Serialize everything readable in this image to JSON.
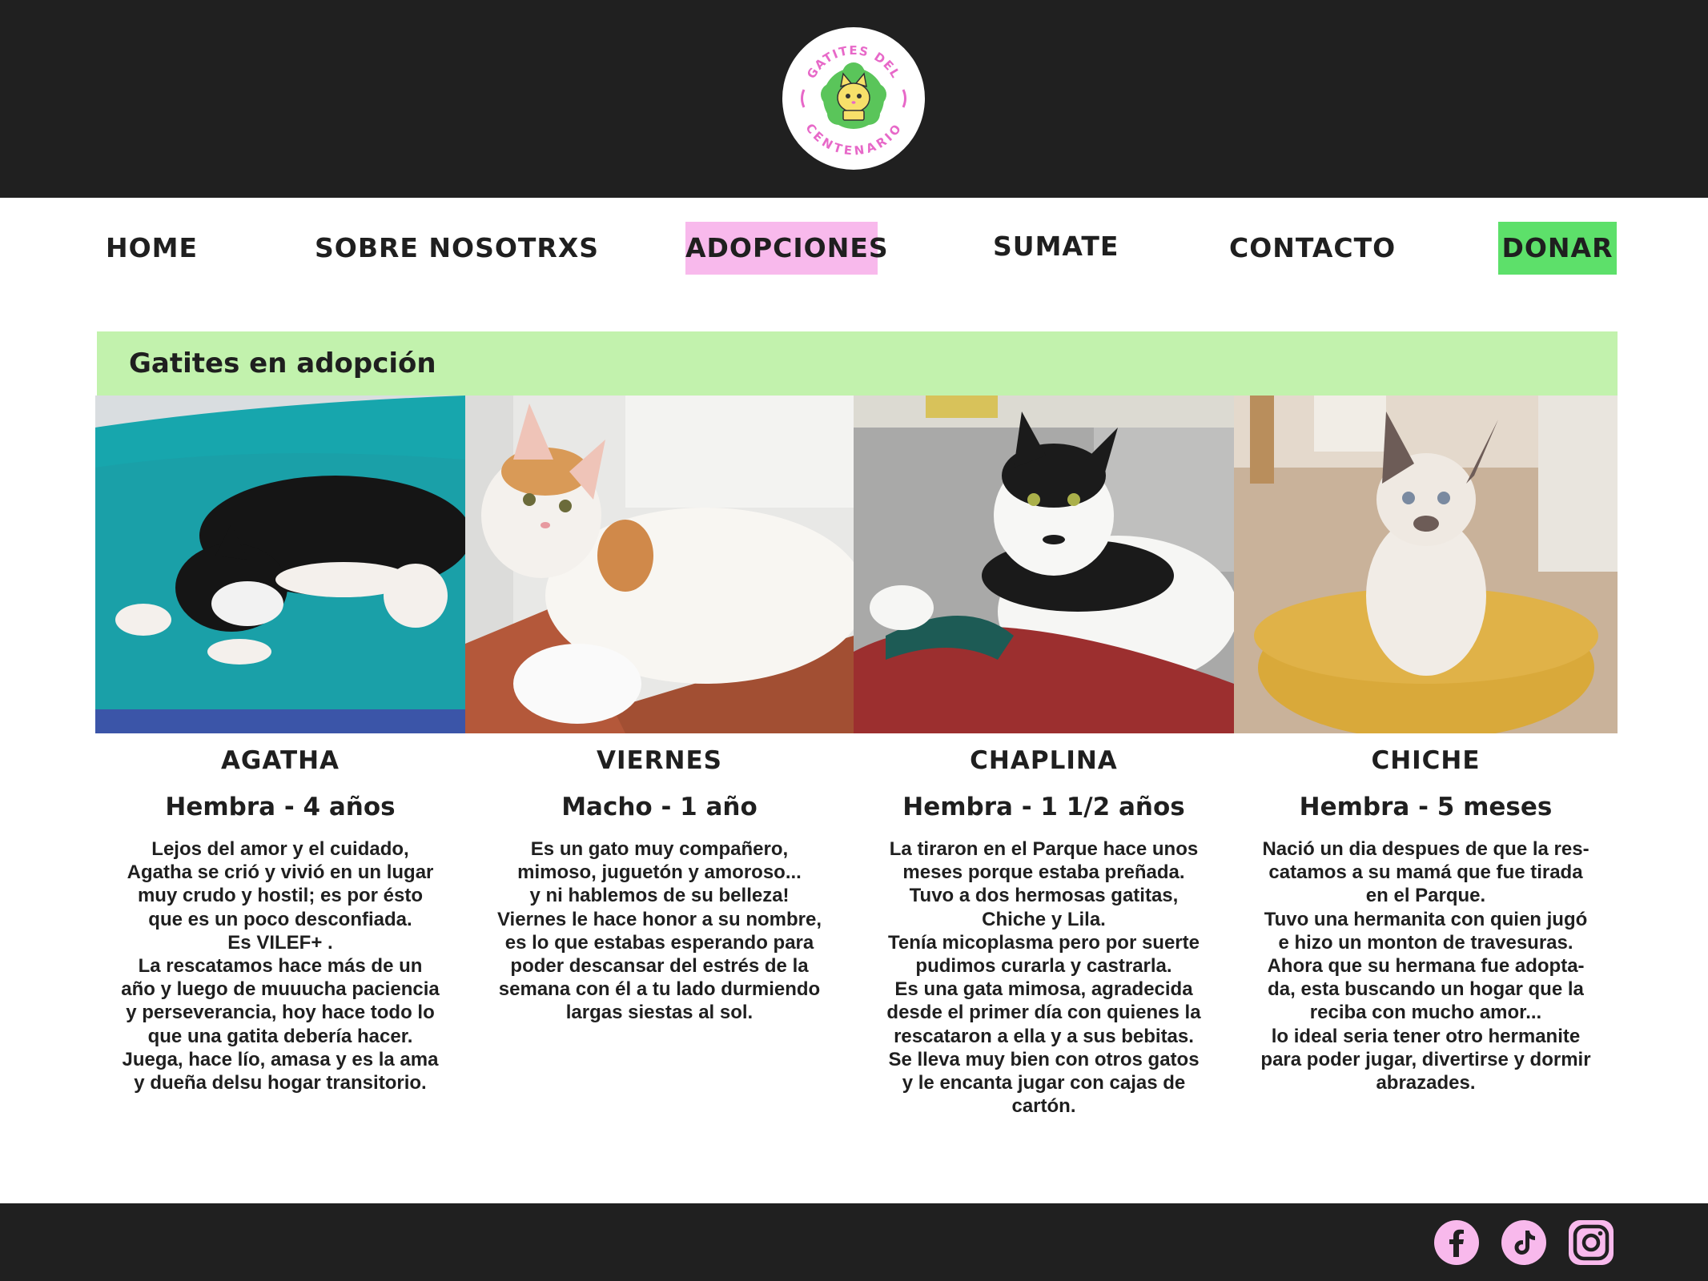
{
  "brand": {
    "logo_text_top": "GATITES DEL",
    "logo_text_bottom": "CENTENARIO",
    "colors": {
      "pink": "#f8b9ec",
      "green": "#5de06a",
      "light_green": "#c2f2ad",
      "dark": "#202020"
    }
  },
  "nav": {
    "home": "HOME",
    "about": "SOBRE NOSOTRXS",
    "adoptions": "ADOPCIONES",
    "join": "SUMATE",
    "contact": "CONTACTO",
    "donate": "DONAR",
    "active": "ADOPCIONES"
  },
  "section": {
    "title": "Gatites en adopción"
  },
  "cats": [
    {
      "name": "AGATHA",
      "info": "Hembra - 4 años",
      "description": "Lejos del amor y el cuidado,\nAgatha se crió y vivió en un lugar\nmuy crudo y hostil; es por ésto\nque es un poco desconfiada.\nEs VILEF+ .\nLa rescatamos hace más de un\naño y luego de muuucha paciencia\ny perseverancia, hoy hace todo lo\nque una gatita debería hacer.\nJuega, hace lío, amasa y es la ama\ny dueña delsu hogar transitorio."
    },
    {
      "name": "VIERNES",
      "info": "Macho - 1 año",
      "description": "Es un gato muy compañero,\nmimoso, juguetón y amoroso...\ny ni hablemos de su belleza!\nViernes le hace honor a su nombre,\nes lo que estabas esperando para\npoder descansar del estrés de la\nsemana con él a tu lado durmiendo\nlargas siestas al sol."
    },
    {
      "name": "CHAPLINA",
      "info": "Hembra - 1 1/2 años",
      "description": "La tiraron en el Parque hace unos\nmeses porque estaba preñada.\nTuvo a dos hermosas gatitas,\nChiche y Lila.\nTenía micoplasma pero por suerte\npudimos curarla y castrarla.\nEs una gata mimosa, agradecida\ndesde el primer día con quienes la\nrescataron a ella y a sus bebitas.\nSe lleva muy bien con otros gatos\ny le encanta jugar con cajas de\ncartón."
    },
    {
      "name": "CHICHE",
      "info": "Hembra - 5 meses",
      "description": "Nació un dia despues de que la res-\ncatamos a su mamá que fue tirada\nen el Parque.\nTuvo una hermanita con quien jugó\ne hizo un monton de travesuras.\nAhora que su hermana fue adopta-\nda, esta buscando un hogar que la\nreciba con mucho amor...\nlo ideal seria tener otro hermanite\npara poder jugar, divertirse y dormir\nabrazades."
    }
  ],
  "footer": {
    "social": [
      "facebook-icon",
      "tiktok-icon",
      "instagram-icon"
    ]
  }
}
